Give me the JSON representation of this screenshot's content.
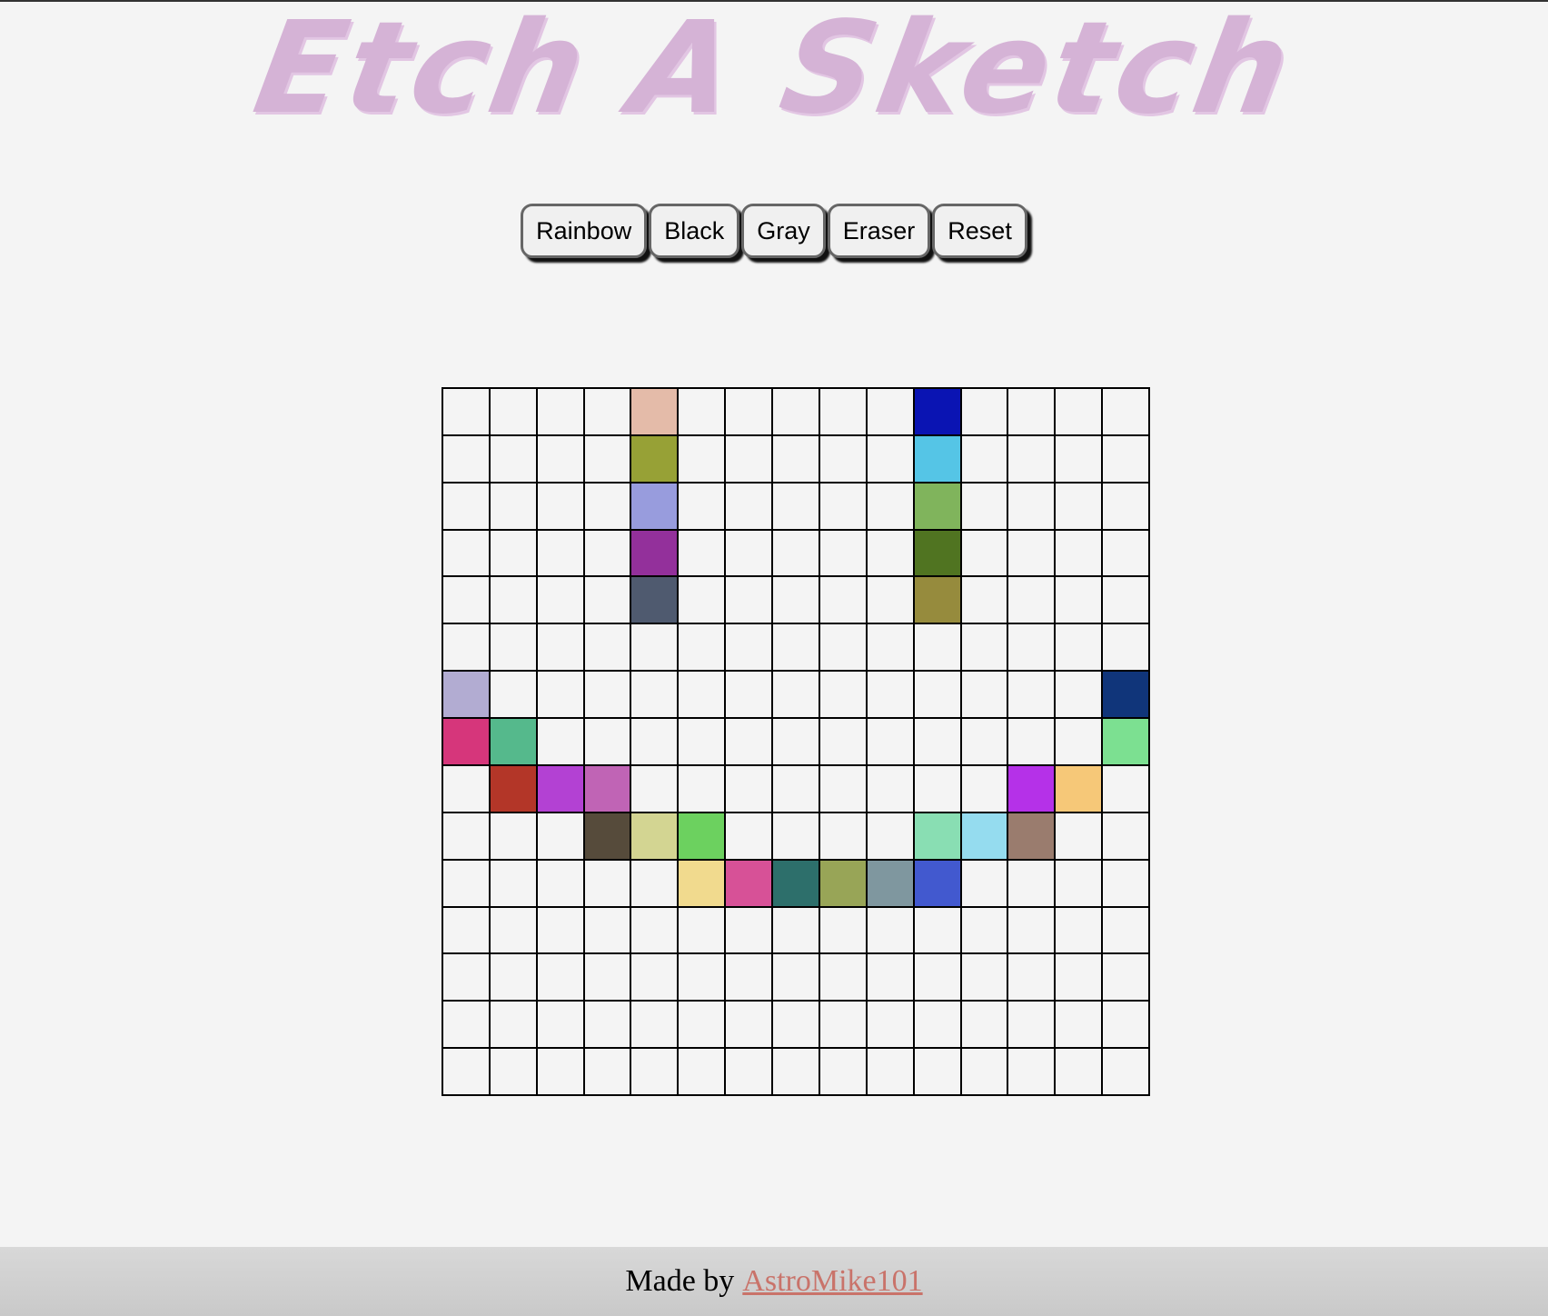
{
  "header": {
    "title": "Etch A Sketch",
    "title_color": "#d5b3d6"
  },
  "toolbar": {
    "buttons": [
      {
        "label": "Rainbow",
        "name": "rainbow-button"
      },
      {
        "label": "Black",
        "name": "black-button"
      },
      {
        "label": "Gray",
        "name": "gray-button"
      },
      {
        "label": "Eraser",
        "name": "eraser-button"
      },
      {
        "label": "Reset",
        "name": "reset-button"
      }
    ]
  },
  "grid": {
    "size": 15,
    "empty_color": "#f4f4f4",
    "filled_cells": [
      {
        "row": 0,
        "col": 4,
        "color": "#e4bba9"
      },
      {
        "row": 1,
        "col": 4,
        "color": "#97a136"
      },
      {
        "row": 2,
        "col": 4,
        "color": "#989cdd"
      },
      {
        "row": 3,
        "col": 4,
        "color": "#93309b"
      },
      {
        "row": 4,
        "col": 4,
        "color": "#4f5a6f"
      },
      {
        "row": 0,
        "col": 10,
        "color": "#0a14b3"
      },
      {
        "row": 1,
        "col": 10,
        "color": "#55c5e6"
      },
      {
        "row": 2,
        "col": 10,
        "color": "#80b45c"
      },
      {
        "row": 3,
        "col": 10,
        "color": "#507421"
      },
      {
        "row": 4,
        "col": 10,
        "color": "#968b3d"
      },
      {
        "row": 6,
        "col": 0,
        "color": "#b2acd2"
      },
      {
        "row": 6,
        "col": 14,
        "color": "#10357a"
      },
      {
        "row": 7,
        "col": 0,
        "color": "#d6367b"
      },
      {
        "row": 7,
        "col": 1,
        "color": "#55b98c"
      },
      {
        "row": 7,
        "col": 14,
        "color": "#7ce091"
      },
      {
        "row": 8,
        "col": 1,
        "color": "#b33628"
      },
      {
        "row": 8,
        "col": 2,
        "color": "#b341d3"
      },
      {
        "row": 8,
        "col": 3,
        "color": "#c064b5"
      },
      {
        "row": 8,
        "col": 12,
        "color": "#b531e8"
      },
      {
        "row": 8,
        "col": 13,
        "color": "#f6c878"
      },
      {
        "row": 9,
        "col": 3,
        "color": "#564b3b"
      },
      {
        "row": 9,
        "col": 4,
        "color": "#d3d592"
      },
      {
        "row": 9,
        "col": 5,
        "color": "#6cd15f"
      },
      {
        "row": 9,
        "col": 10,
        "color": "#89deb3"
      },
      {
        "row": 9,
        "col": 11,
        "color": "#95dcef"
      },
      {
        "row": 9,
        "col": 12,
        "color": "#9a7c6e"
      },
      {
        "row": 10,
        "col": 5,
        "color": "#f1da8e"
      },
      {
        "row": 10,
        "col": 6,
        "color": "#d75197"
      },
      {
        "row": 10,
        "col": 7,
        "color": "#2d6f6b"
      },
      {
        "row": 10,
        "col": 8,
        "color": "#98a557"
      },
      {
        "row": 10,
        "col": 9,
        "color": "#7f979f"
      },
      {
        "row": 10,
        "col": 10,
        "color": "#4259cf"
      }
    ]
  },
  "footer": {
    "prefix": "Made by",
    "author_link": "AstroMike101",
    "link_color": "#c9736a"
  }
}
